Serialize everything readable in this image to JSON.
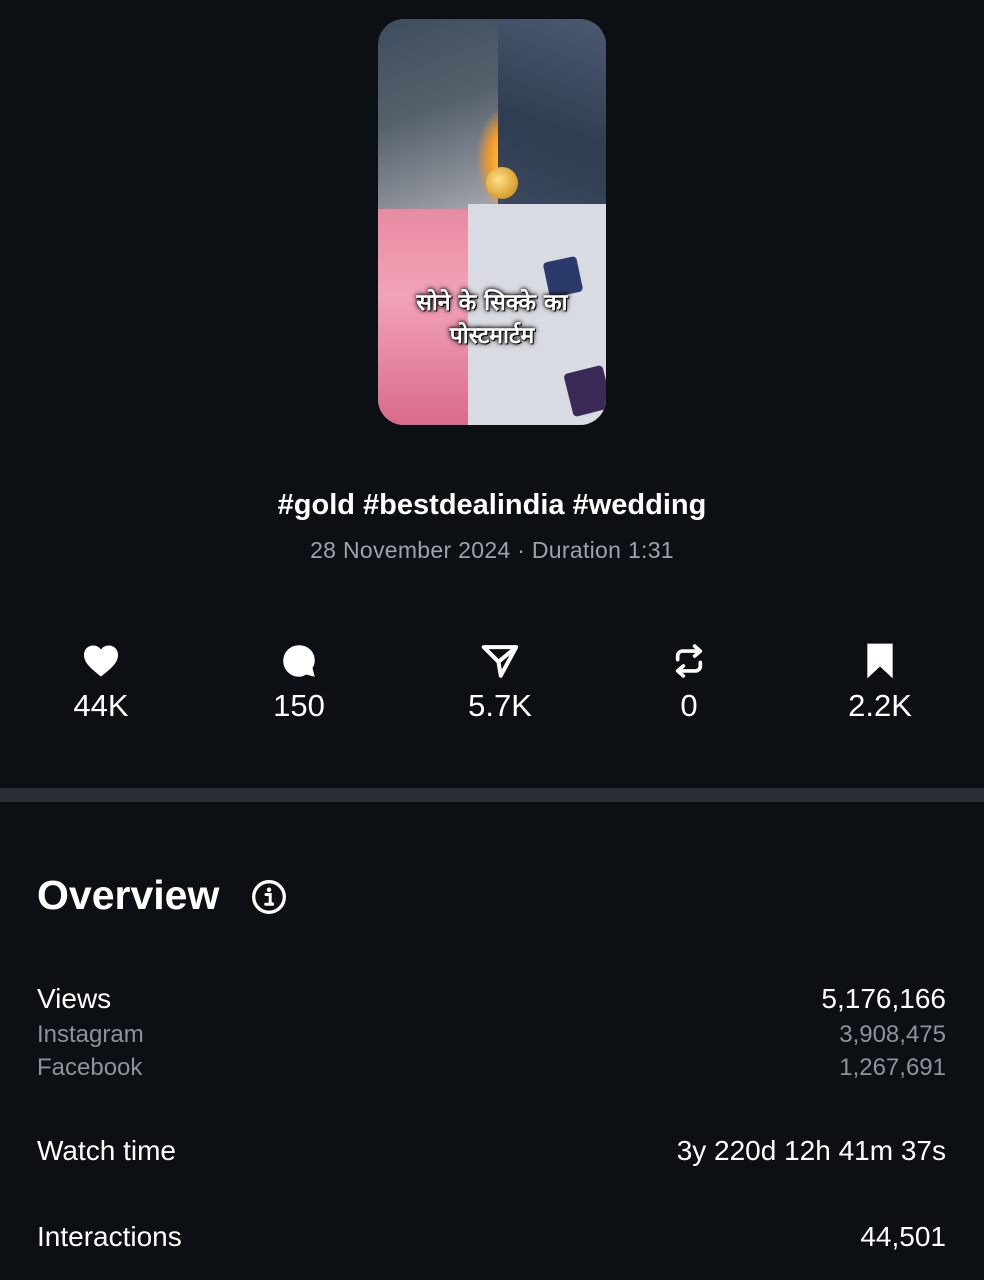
{
  "post": {
    "thumbnail_caption_line1": "सोने के सिक्के का",
    "thumbnail_caption_line2": "पोस्टमार्टम",
    "title": "#gold #bestdealindia #wedding",
    "date": "28 November 2024",
    "separator": "·",
    "duration_label": "Duration",
    "duration": "1:31"
  },
  "stats": [
    {
      "icon": "heart-icon",
      "value": "44K"
    },
    {
      "icon": "comment-icon",
      "value": "150"
    },
    {
      "icon": "share-icon",
      "value": "5.7K"
    },
    {
      "icon": "repost-icon",
      "value": "0"
    },
    {
      "icon": "bookmark-icon",
      "value": "2.2K"
    }
  ],
  "overview": {
    "title": "Overview",
    "info_icon": "info-icon",
    "views": {
      "label": "Views",
      "value": "5,176,166",
      "instagram_label": "Instagram",
      "instagram_value": "3,908,475",
      "facebook_label": "Facebook",
      "facebook_value": "1,267,691"
    },
    "watch_time": {
      "label": "Watch time",
      "value": "3y 220d 12h 41m 37s"
    },
    "interactions": {
      "label": "Interactions",
      "value": "44,501"
    }
  },
  "colors": {
    "background": "#0c0f14",
    "divider": "#2a2d33",
    "secondary_text": "#9ea3ab"
  }
}
